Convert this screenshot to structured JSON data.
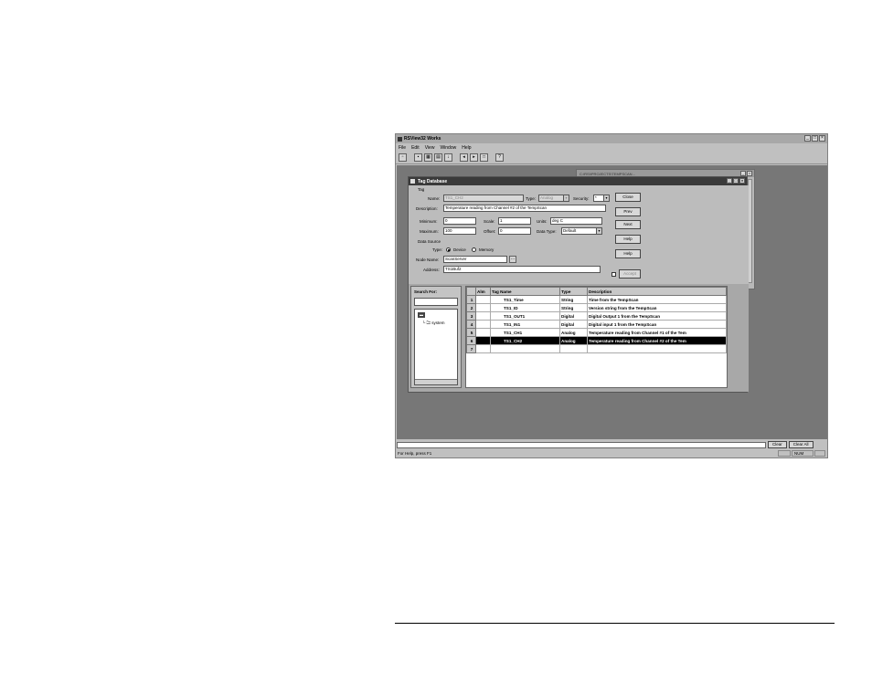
{
  "app": {
    "title": "RSView32 Works",
    "menus": [
      "File",
      "Edit",
      "View",
      "Window",
      "Help"
    ],
    "title_buttons": [
      "_",
      "□",
      "×"
    ]
  },
  "background_window": {
    "title": "C:\\RSI\\PROJECTS\\TEMPSCAN..."
  },
  "tag_db": {
    "title": "Tag Database",
    "group_tag": "Tag",
    "name_label": "Name:",
    "name_value": "TS1_CH2",
    "type_label": "Type:",
    "type_value": "Analog",
    "security_label": "Security:",
    "security_value": "*",
    "description_label": "Description:",
    "description_value": "Temperature reading from Channel #2 of the TempScan",
    "minimum_label": "Minimum:",
    "minimum_value": "0",
    "scale_label": "Scale:",
    "scale_value": "1",
    "units_label": "Units:",
    "units_value": "deg C",
    "maximum_label": "Maximum:",
    "maximum_value": "100",
    "offset_label": "Offset:",
    "offset_value": "0",
    "datatype_label": "Data Type:",
    "datatype_value": "Default",
    "group_source": "Data Source",
    "source_type_label": "Type:",
    "source_device": "Device",
    "source_memory": "Memory",
    "nodename_label": "Node Name:",
    "nodename_value": "ScanServer",
    "address_label": "Address:",
    "address_value": "TS1Buf2",
    "buttons": {
      "close": "Close",
      "prev": "Prev",
      "next": "Next",
      "help": "Help",
      "accept": "Accept"
    },
    "search_label": "Search For:",
    "tree_item": "system",
    "grid": {
      "headers": [
        "",
        "Alm",
        "Tag Name",
        "Type",
        "Description"
      ],
      "rows": [
        {
          "n": "1",
          "name": "TS1_Time",
          "type": "String",
          "desc": "Time from the TempScan"
        },
        {
          "n": "2",
          "name": "TS1_ID",
          "type": "String",
          "desc": "Version string from the TempScan"
        },
        {
          "n": "3",
          "name": "TS1_OUT1",
          "type": "Digital",
          "desc": "Digital Output 1 from the TempScan"
        },
        {
          "n": "4",
          "name": "TS1_IN1",
          "type": "Digital",
          "desc": "Digital input 1 from the TempScan"
        },
        {
          "n": "5",
          "name": "TS1_CH1",
          "type": "Analog",
          "desc": "Temperature reading from Channel #1 of the Tem"
        },
        {
          "n": "6",
          "name": "TS1_CH2",
          "type": "Analog",
          "desc": "Temperature reading from Channel #2 of the Tem"
        },
        {
          "n": "7",
          "name": "",
          "type": "",
          "desc": ""
        }
      ]
    }
  },
  "output_bar": {
    "clear": "Clear",
    "clear_all": "Clear All"
  },
  "status": {
    "text": "For Help, press F1",
    "num": "NUM"
  }
}
